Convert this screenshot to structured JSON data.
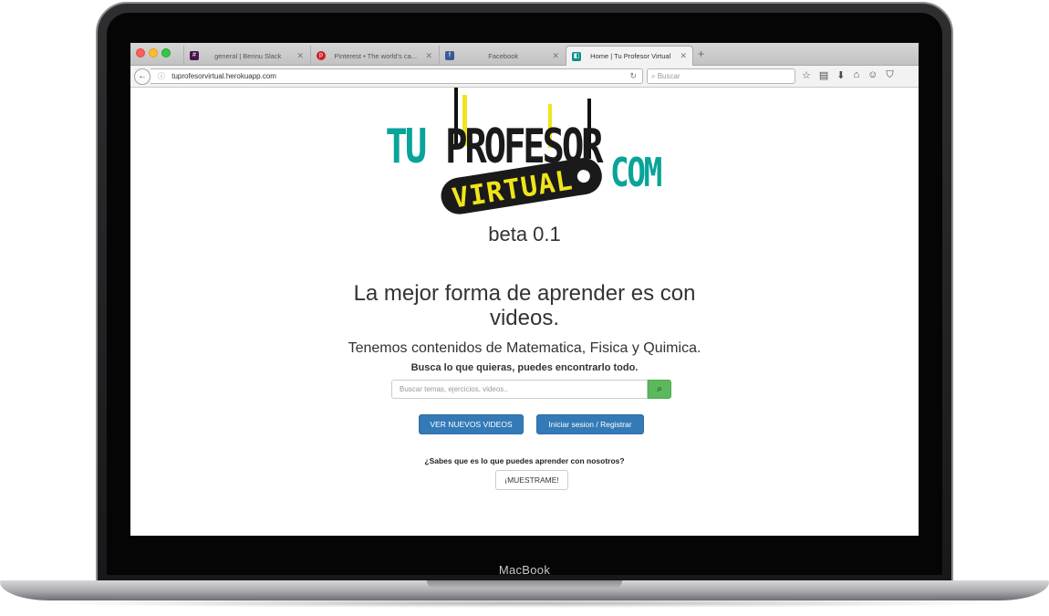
{
  "device": {
    "brand": "MacBook"
  },
  "browser": {
    "tabs": [
      {
        "title": "general | Bennu Slack",
        "icon": "slack-icon",
        "active": false
      },
      {
        "title": "Pinterest • The world's ca...",
        "icon": "pinterest-icon",
        "active": false
      },
      {
        "title": "Facebook",
        "icon": "facebook-icon",
        "active": false
      },
      {
        "title": "Home | Tu Profesor Virtual",
        "icon": "site-icon",
        "active": true
      }
    ],
    "url": "tuprofesorvirtual.herokuapp.com",
    "search_placeholder": "Buscar",
    "colors": {
      "slack": "#4a154b",
      "pinterest": "#cb2027",
      "facebook": "#3b5998",
      "site": "#0d8e8a"
    }
  },
  "page": {
    "logo": {
      "top_line": [
        "TU",
        "PROFESOR"
      ],
      "tag": "VIRTUAL",
      "suffix": "COM",
      "colors": {
        "teal": "#0aa39a",
        "black": "#1a1a1a",
        "yellow": "#f0e51a"
      }
    },
    "beta": "beta 0.1",
    "headline": "La mejor forma de aprender es con videos.",
    "subtitle": "Tenemos contenidos de Matematica, Fisica y Quimica.",
    "prompt": "Busca lo que quieras, puedes encontrarlo todo.",
    "search": {
      "placeholder": "Buscar temas, ejercicios, videos.."
    },
    "buttons": {
      "videos": "VER NUEVOS VIDEOS",
      "login": "Iniciar sesion / Registrar"
    },
    "question": "¿Sabes que es lo que puedes aprender con nosotros?",
    "show_button": "¡MUESTRAME!"
  }
}
